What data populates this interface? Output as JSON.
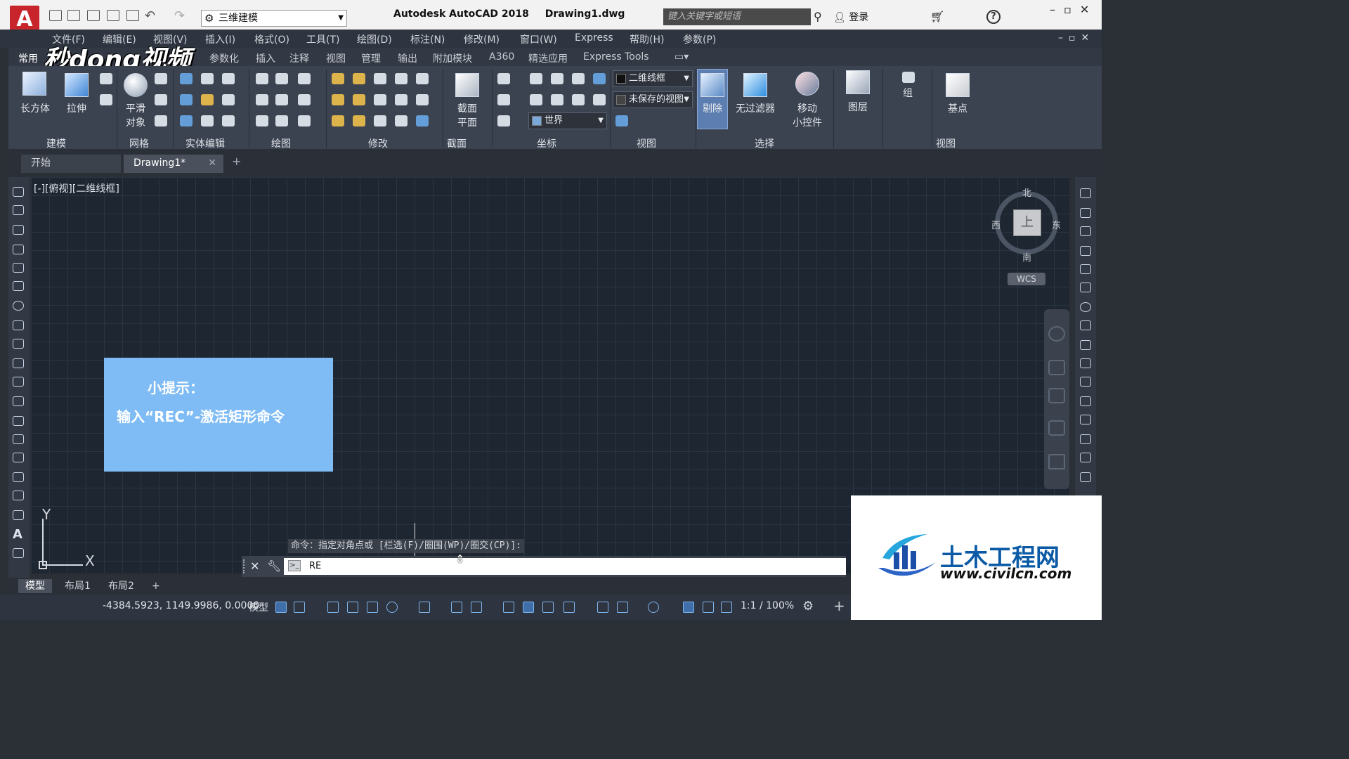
{
  "titlebar": {
    "logo": "A",
    "workspace": "三维建模",
    "app_title": "Autodesk AutoCAD 2018",
    "file_name": "Drawing1.dwg",
    "search_placeholder": "键入关键字或短语",
    "login": "登录"
  },
  "menubar": [
    "文件(F)",
    "编辑(E)",
    "视图(V)",
    "插入(I)",
    "格式(O)",
    "工具(T)",
    "绘图(D)",
    "标注(N)",
    "修改(M)",
    "窗口(W)",
    "Express",
    "帮助(H)",
    "参数(P)"
  ],
  "ribbon_tabs": [
    "常用",
    "实体",
    "曲面",
    "网格",
    "可视化",
    "参数化",
    "插入",
    "注释",
    "视图",
    "管理",
    "输出",
    "附加模块",
    "A360",
    "精选应用",
    "Express Tools"
  ],
  "ribbon": {
    "box_label": "长方体",
    "extrude_label": "拉伸",
    "smooth_label": [
      "平滑",
      "对象"
    ],
    "section_label": [
      "截面",
      "平面"
    ],
    "visual_style": "二维线框",
    "saved_view": "未保存的视图",
    "ucs_world": "世界",
    "remove_label": "剔除",
    "nofilter_label": "无过滤器",
    "gizmo_label": [
      "移动",
      "小控件"
    ],
    "layers_label": "图层",
    "group_label": "组",
    "base_label": "基点",
    "panel_titles": [
      "建模",
      "网格",
      "实体编辑",
      "绘图",
      "修改",
      "截面",
      "坐标",
      "视图",
      "选择",
      "视图"
    ]
  },
  "doc_tabs": {
    "start": "开始",
    "drawing": "Drawing1*"
  },
  "viewport_label": "[-][俯视][二维线框]",
  "viewcube": {
    "north": "北",
    "south": "南",
    "east": "东",
    "west": "西",
    "face": "上",
    "wcs": "WCS"
  },
  "tip": {
    "title": "小提示：",
    "body": "输入“REC”-激活矩形命令"
  },
  "ucs": {
    "y": "Y",
    "x": "X"
  },
  "command": {
    "history": "命令：指定对角点或 [栏选(F)/圈围(WP)/圈交(CP)]:",
    "input": "RE"
  },
  "layout_tabs": [
    "模型",
    "布局1",
    "布局2"
  ],
  "status": {
    "coords": "-4384.5923, 1149.9986, 0.0000",
    "model": "模型",
    "scale": "1:1 / 100%"
  },
  "watermark": "秒dong视频",
  "civil_logo": {
    "name": "土木工程网",
    "url": "www.civilcn.com"
  }
}
